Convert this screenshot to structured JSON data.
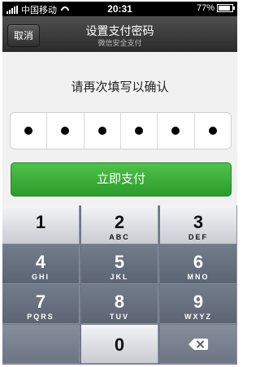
{
  "status": {
    "carrier": "中国移动",
    "time": "20:31",
    "battery": "77%",
    "battery_level": 0.77
  },
  "nav": {
    "cancel_label": "取消",
    "title": "设置支付密码",
    "subtitle": "微信安全支付"
  },
  "prompt": "请再次填写以确认",
  "pin": {
    "length": 6,
    "filled": 6
  },
  "pay_button": "立即支付",
  "keypad": {
    "rows": [
      [
        {
          "num": "1",
          "letters": ""
        },
        {
          "num": "2",
          "letters": "ABC"
        },
        {
          "num": "3",
          "letters": "DEF"
        }
      ],
      [
        {
          "num": "4",
          "letters": "GHI"
        },
        {
          "num": "5",
          "letters": "JKL"
        },
        {
          "num": "6",
          "letters": "MNO"
        }
      ],
      [
        {
          "num": "7",
          "letters": "PQRS"
        },
        {
          "num": "8",
          "letters": "TUV"
        },
        {
          "num": "9",
          "letters": "WXYZ"
        }
      ],
      [
        {
          "num": "",
          "letters": ""
        },
        {
          "num": "0",
          "letters": ""
        },
        {
          "num": "",
          "letters": ""
        }
      ]
    ],
    "delete_icon": "backspace-icon"
  }
}
